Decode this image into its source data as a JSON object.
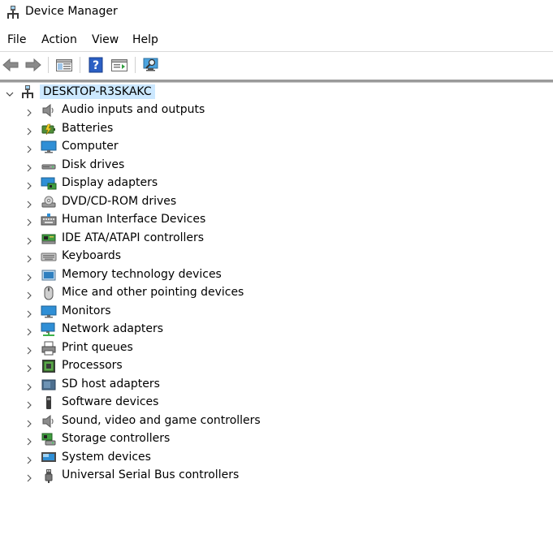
{
  "window": {
    "title": "Device Manager"
  },
  "menu": [
    "File",
    "Action",
    "View",
    "Help"
  ],
  "toolbar": {
    "buttons": [
      "back-icon",
      "forward-icon",
      "show-hide-console-tree-icon",
      "help-icon",
      "properties-icon",
      "scan-hardware-icon"
    ]
  },
  "tree": {
    "root": {
      "label": "DESKTOP-R3SKAKC",
      "icon": "computer-network-icon"
    },
    "items": [
      {
        "label": "Audio inputs and outputs",
        "icon": "speaker-icon"
      },
      {
        "label": "Batteries",
        "icon": "battery-icon"
      },
      {
        "label": "Computer",
        "icon": "monitor-icon"
      },
      {
        "label": "Disk drives",
        "icon": "disk-drive-icon"
      },
      {
        "label": "Display adapters",
        "icon": "display-adapter-icon"
      },
      {
        "label": "DVD/CD-ROM drives",
        "icon": "dvd-drive-icon"
      },
      {
        "label": "Human Interface Devices",
        "icon": "hid-icon"
      },
      {
        "label": "IDE ATA/ATAPI controllers",
        "icon": "ide-controller-icon"
      },
      {
        "label": "Keyboards",
        "icon": "keyboard-icon"
      },
      {
        "label": "Memory technology devices",
        "icon": "memory-icon"
      },
      {
        "label": "Mice and other pointing devices",
        "icon": "mouse-icon"
      },
      {
        "label": "Monitors",
        "icon": "monitor-icon"
      },
      {
        "label": "Network adapters",
        "icon": "network-adapter-icon"
      },
      {
        "label": "Print queues",
        "icon": "printer-icon"
      },
      {
        "label": "Processors",
        "icon": "processor-icon"
      },
      {
        "label": "SD host adapters",
        "icon": "sd-card-icon"
      },
      {
        "label": "Software devices",
        "icon": "software-device-icon"
      },
      {
        "label": "Sound, video and game controllers",
        "icon": "speaker-icon"
      },
      {
        "label": "Storage controllers",
        "icon": "storage-controller-icon"
      },
      {
        "label": "System devices",
        "icon": "system-devices-icon"
      },
      {
        "label": "Universal Serial Bus controllers",
        "icon": "usb-icon"
      }
    ]
  },
  "colors": {
    "selection": "#cce8ff",
    "accent": "#0078d7"
  }
}
